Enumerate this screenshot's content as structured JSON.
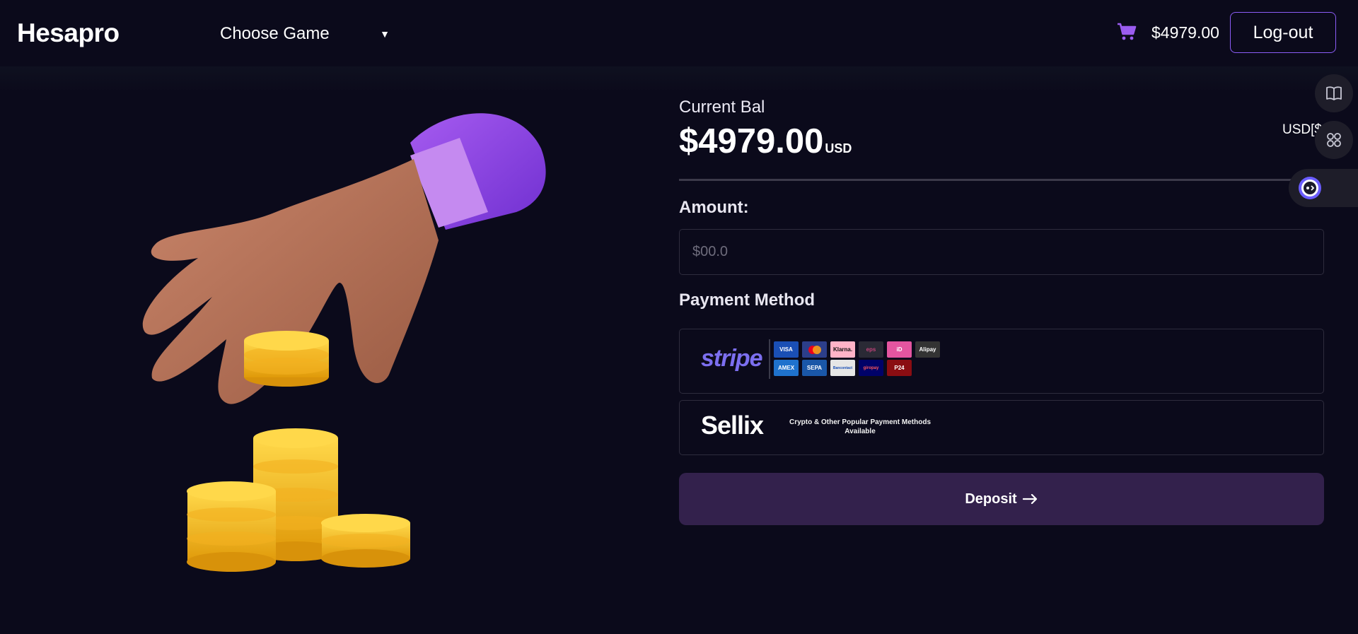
{
  "header": {
    "brand": "Hesapro",
    "game_select": "Choose Game",
    "balance": "$4979.00",
    "logout_label": "Log-out"
  },
  "balance": {
    "label": "Current Bal",
    "amount": "$4979.00",
    "unit": "USD",
    "currency_code": "USD[$"
  },
  "amount": {
    "label": "Amount:",
    "placeholder": "$00.0"
  },
  "payment": {
    "label": "Payment Method",
    "stripe": {
      "logo": "stripe",
      "badges": [
        "VISA",
        "MC",
        "Klarna.",
        "eps",
        "iD",
        "Alipay",
        "AMEX",
        "SEPA",
        "Bancontact",
        "giropay",
        "P24"
      ]
    },
    "sellix": {
      "logo": "Sellix",
      "note": "Crypto & Other Popular Payment Methods Available"
    }
  },
  "deposit": {
    "label": "Deposit"
  },
  "icons": {
    "cart": "cart-icon",
    "book": "book-icon",
    "apps": "apps-icon",
    "assistant": "assistant-icon",
    "arrow": "arrow-right-icon"
  },
  "colors": {
    "background": "#0b0a1b",
    "accent": "#8b5cf6",
    "deposit_button": "#33214c",
    "stripe_brand": "#7c6ff0"
  }
}
